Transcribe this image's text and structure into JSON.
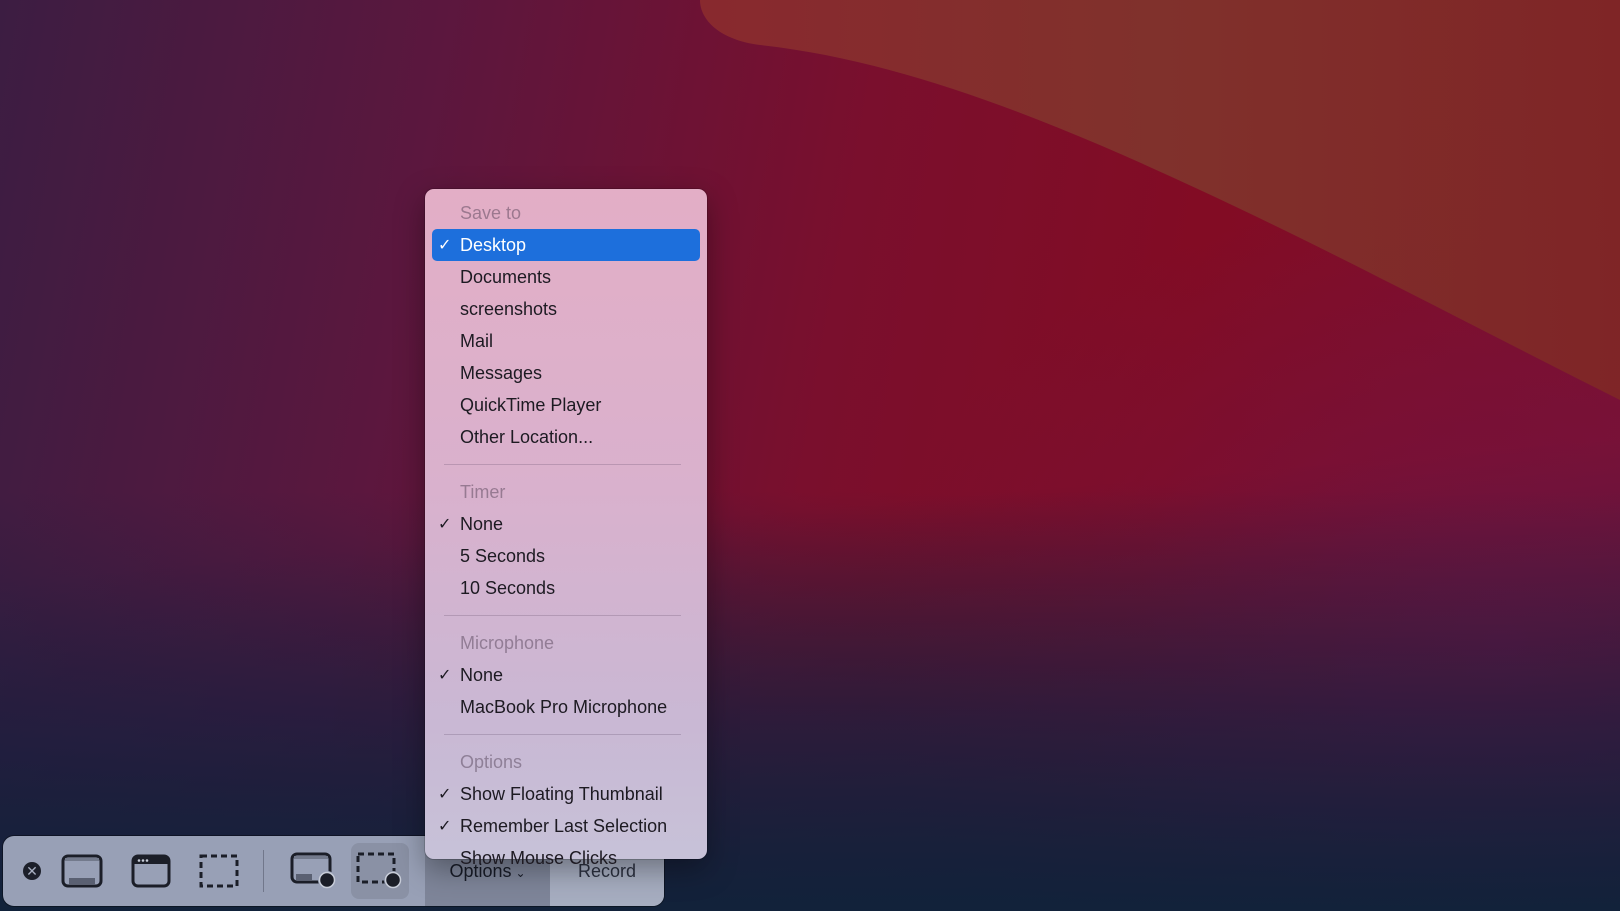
{
  "toolbar": {
    "buttons": [
      {
        "id": "close",
        "icon": "close-icon",
        "glyph": "✕"
      },
      {
        "id": "capture-entire-screen",
        "icon": "entire-screen-icon"
      },
      {
        "id": "capture-window",
        "icon": "window-icon"
      },
      {
        "id": "capture-selection",
        "icon": "selection-icon"
      },
      {
        "id": "record-entire-screen",
        "icon": "record-screen-icon"
      },
      {
        "id": "record-selection",
        "icon": "record-selection-icon",
        "active": true
      }
    ],
    "options_label": "Options",
    "options_chevron": "⌄",
    "record_label": "Record"
  },
  "menu": {
    "sections": [
      {
        "header": "Save to",
        "items": [
          {
            "label": "Desktop",
            "checked": true,
            "highlighted": true
          },
          {
            "label": "Documents",
            "checked": false
          },
          {
            "label": "screenshots",
            "checked": false
          },
          {
            "label": "Mail",
            "checked": false
          },
          {
            "label": "Messages",
            "checked": false
          },
          {
            "label": "QuickTime Player",
            "checked": false
          },
          {
            "label": "Other Location...",
            "checked": false
          }
        ]
      },
      {
        "header": "Timer",
        "items": [
          {
            "label": "None",
            "checked": true
          },
          {
            "label": "5 Seconds",
            "checked": false
          },
          {
            "label": "10 Seconds",
            "checked": false
          }
        ]
      },
      {
        "header": "Microphone",
        "items": [
          {
            "label": "None",
            "checked": true
          },
          {
            "label": "MacBook Pro Microphone",
            "checked": false
          }
        ]
      },
      {
        "header": "Options",
        "items": [
          {
            "label": "Show Floating Thumbnail",
            "checked": true
          },
          {
            "label": "Remember Last Selection",
            "checked": true
          },
          {
            "label": "Show Mouse Clicks",
            "checked": false
          }
        ]
      }
    ],
    "check_glyph": "✓"
  },
  "colors": {
    "highlight": "#1d6fdc",
    "wallpaper_red": "#820c24",
    "wallpaper_orange": "#80302a",
    "wallpaper_navy": "#12223a"
  }
}
